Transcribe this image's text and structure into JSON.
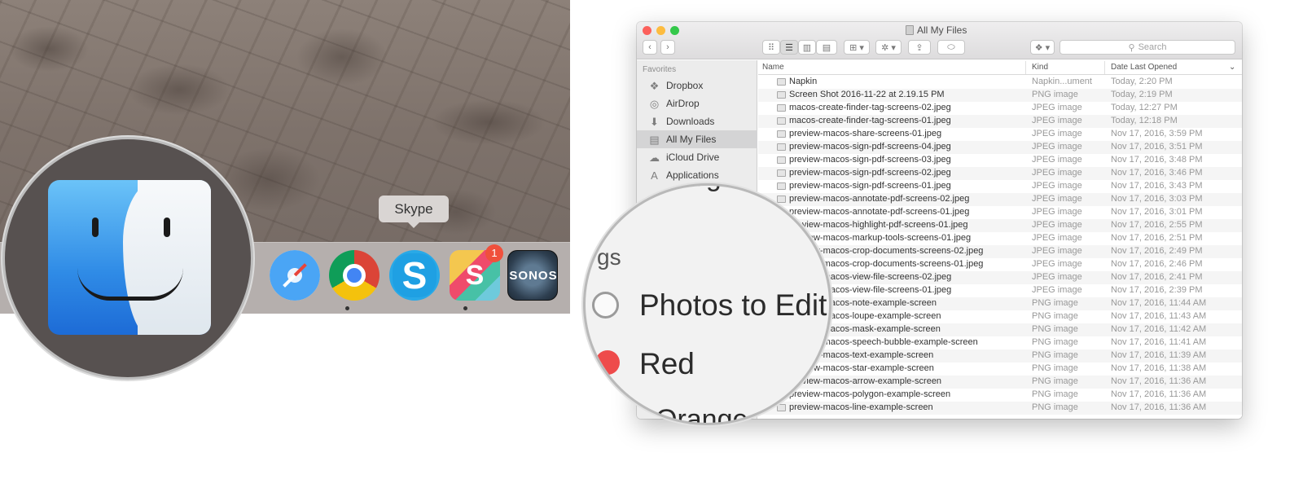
{
  "left_scene": {
    "dock_tooltip": "Skype",
    "dock_apps": [
      {
        "name": "Safari",
        "icon": "safari-icon"
      },
      {
        "name": "Google Chrome",
        "icon": "chrome-icon"
      },
      {
        "name": "Skype",
        "icon": "skype-icon",
        "glyph": "S"
      },
      {
        "name": "Slack",
        "icon": "slack-icon",
        "glyph": "S",
        "badge": "1"
      },
      {
        "name": "Sonos",
        "icon": "sonos-icon",
        "label": "SONOS"
      }
    ],
    "magnified_app": "finder-icon"
  },
  "finder": {
    "window_title": "All My Files",
    "toolbar": {
      "back": "‹",
      "forward": "›",
      "view_icon": "⠿",
      "view_list": "☰",
      "view_column": "▥",
      "view_cover": "▤",
      "arrange": "⊞ ▾",
      "action": "✲ ▾",
      "share": "⇪",
      "tags": "⬭",
      "dropbox": "❖ ▾",
      "search_icon": "⚲",
      "search_placeholder": "Search"
    },
    "sidebar": {
      "heading": "Favorites",
      "items": [
        {
          "label": "Dropbox",
          "icon": "❖"
        },
        {
          "label": "AirDrop",
          "icon": "◎"
        },
        {
          "label": "Downloads",
          "icon": "⬇"
        },
        {
          "label": "All My Files",
          "icon": "▤",
          "selected": true
        },
        {
          "label": "iCloud Drive",
          "icon": "☁"
        },
        {
          "label": "Applications",
          "icon": "A"
        }
      ]
    },
    "columns": {
      "name": "Name",
      "kind": "Kind",
      "date": "Date Last Opened",
      "sort_indicator": "⌄"
    },
    "rows": [
      {
        "name": "Napkin",
        "kind": "Napkin...ument",
        "date": "Today, 2:20 PM"
      },
      {
        "name": "Screen Shot 2016-11-22 at 2.19.15 PM",
        "kind": "PNG image",
        "date": "Today, 2:19 PM"
      },
      {
        "name": "macos-create-finder-tag-screens-02.jpeg",
        "kind": "JPEG image",
        "date": "Today, 12:27 PM"
      },
      {
        "name": "macos-create-finder-tag-screens-01.jpeg",
        "kind": "JPEG image",
        "date": "Today, 12:18 PM"
      },
      {
        "name": "preview-macos-share-screens-01.jpeg",
        "kind": "JPEG image",
        "date": "Nov 17, 2016, 3:59 PM"
      },
      {
        "name": "preview-macos-sign-pdf-screens-04.jpeg",
        "kind": "JPEG image",
        "date": "Nov 17, 2016, 3:51 PM"
      },
      {
        "name": "preview-macos-sign-pdf-screens-03.jpeg",
        "kind": "JPEG image",
        "date": "Nov 17, 2016, 3:48 PM"
      },
      {
        "name": "preview-macos-sign-pdf-screens-02.jpeg",
        "kind": "JPEG image",
        "date": "Nov 17, 2016, 3:46 PM"
      },
      {
        "name": "preview-macos-sign-pdf-screens-01.jpeg",
        "kind": "JPEG image",
        "date": "Nov 17, 2016, 3:43 PM"
      },
      {
        "name": "preview-macos-annotate-pdf-screens-02.jpeg",
        "kind": "JPEG image",
        "date": "Nov 17, 2016, 3:03 PM"
      },
      {
        "name": "preview-macos-annotate-pdf-screens-01.jpeg",
        "kind": "JPEG image",
        "date": "Nov 17, 2016, 3:01 PM"
      },
      {
        "name": "preview-macos-highlight-pdf-screens-01.jpeg",
        "kind": "JPEG image",
        "date": "Nov 17, 2016, 2:55 PM"
      },
      {
        "name": "preview-macos-markup-tools-screens-01.jpeg",
        "kind": "JPEG image",
        "date": "Nov 17, 2016, 2:51 PM"
      },
      {
        "name": "preview-macos-crop-documents-screens-02.jpeg",
        "kind": "JPEG image",
        "date": "Nov 17, 2016, 2:49 PM"
      },
      {
        "name": "preview-macos-crop-documents-screens-01.jpeg",
        "kind": "JPEG image",
        "date": "Nov 17, 2016, 2:46 PM"
      },
      {
        "name": "preview-macos-view-file-screens-02.jpeg",
        "kind": "JPEG image",
        "date": "Nov 17, 2016, 2:41 PM"
      },
      {
        "name": "preview-macos-view-file-screens-01.jpeg",
        "kind": "JPEG image",
        "date": "Nov 17, 2016, 2:39 PM"
      },
      {
        "name": "preview-macos-note-example-screen",
        "kind": "PNG image",
        "date": "Nov 17, 2016, 11:44 AM"
      },
      {
        "name": "preview-macos-loupe-example-screen",
        "kind": "PNG image",
        "date": "Nov 17, 2016, 11:43 AM"
      },
      {
        "name": "preview-macos-mask-example-screen",
        "kind": "PNG image",
        "date": "Nov 17, 2016, 11:42 AM"
      },
      {
        "name": "preview-macos-speech-bubble-example-screen",
        "kind": "PNG image",
        "date": "Nov 17, 2016, 11:41 AM"
      },
      {
        "name": "preview-macos-text-example-screen",
        "kind": "PNG image",
        "date": "Nov 17, 2016, 11:39 AM"
      },
      {
        "name": "preview-macos-star-example-screen",
        "kind": "PNG image",
        "date": "Nov 17, 2016, 11:38 AM"
      },
      {
        "name": "preview-macos-arrow-example-screen",
        "kind": "PNG image",
        "date": "Nov 17, 2016, 11:36 AM"
      },
      {
        "name": "preview-macos-polygon-example-screen",
        "kind": "PNG image",
        "date": "Nov 17, 2016, 11:36 AM"
      },
      {
        "name": "preview-macos-line-example-screen",
        "kind": "PNG image",
        "date": "Nov 17, 2016, 11:36 AM"
      }
    ],
    "magnifier": {
      "partial_top": "Progre",
      "section_partial": "gs",
      "tag_1": "Photos to Edit",
      "tag_2": "Red",
      "tag_3_partial": "Orange",
      "tag_2_color": "#ee4b4b"
    }
  },
  "colors": {
    "close": "#fc605b",
    "minimize": "#fdbc40",
    "zoom": "#34c84a",
    "sidebar_bg": "#ececec",
    "selection": "#d4d4d5"
  }
}
